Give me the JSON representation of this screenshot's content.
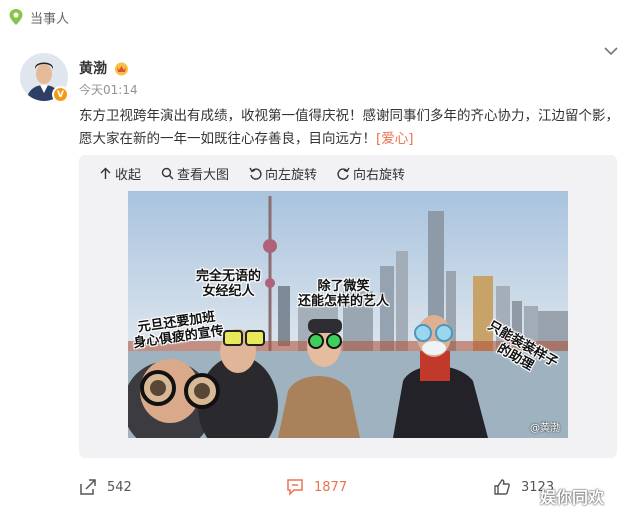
{
  "header": {
    "label": "当事人"
  },
  "post": {
    "username": "黄渤",
    "time": "今天01:14",
    "text_main": "东方卫视跨年演出有成绩，收视第一值得庆祝！感谢同事们多年的齐心协力，江边留个影，愿大家在新的一年一如既往心存善良，目向远方！",
    "text_tag": "[爱心]",
    "verified_badge": "V"
  },
  "image_toolbar": {
    "collapse": "收起",
    "view_large": "查看大图",
    "rotate_left": "向左旋转",
    "rotate_right": "向右旋转"
  },
  "photo": {
    "caption1": "完全无语的\n女经纪人",
    "caption2": "除了微笑\n还能怎样的艺人",
    "caption3": "元旦还要加班\n身心俱疲的宣传",
    "caption4": "只能装装样子\n的助理",
    "watermark": "@黄渤"
  },
  "actions": {
    "share_count": "542",
    "comment_count": "1877",
    "like_count": "3123"
  },
  "overlay_watermark": "娱你同欢",
  "colors": {
    "accent": "#eb7350",
    "badge": "#f59a14",
    "pin": "#8bc34a"
  }
}
